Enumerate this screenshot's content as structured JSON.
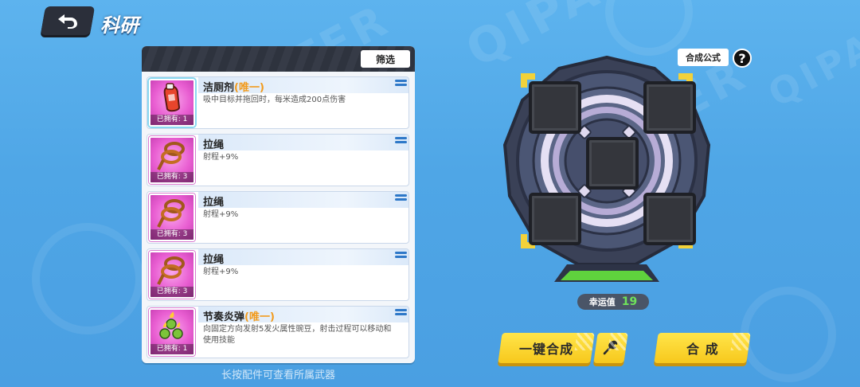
{
  "header": {
    "title": "科研",
    "back_icon": "back-arrow-icon"
  },
  "panel": {
    "filter_label": "筛选",
    "hint": "长按配件可查看所属武器",
    "items": [
      {
        "name": "洁厕剂",
        "tag": "(唯一)",
        "desc": "吸中目标并拖回时，每米造成200点伤害",
        "owned": "已拥有: 1",
        "icon": "cleaner-bottle-icon",
        "selected": true
      },
      {
        "name": "拉绳",
        "tag": "",
        "desc": "射程+9%",
        "owned": "已拥有: 3",
        "icon": "rope-icon",
        "selected": false
      },
      {
        "name": "拉绳",
        "tag": "",
        "desc": "射程+9%",
        "owned": "已拥有: 3",
        "icon": "rope-icon",
        "selected": false
      },
      {
        "name": "拉绳",
        "tag": "",
        "desc": "射程+9%",
        "owned": "已拥有: 3",
        "icon": "rope-icon",
        "selected": false
      },
      {
        "name": "节奏炎弹",
        "tag": "(唯一)",
        "desc": "向固定方向发射5发火属性豌豆，射击过程可以移动和使用技能",
        "owned": "已拥有: 1",
        "icon": "fire-peas-icon",
        "selected": false
      }
    ]
  },
  "synth": {
    "formula_label": "合成公式",
    "help_label": "?",
    "luck_label": "幸运值",
    "luck_value": "19",
    "auto_label": "一键合成",
    "synth_label": "合 成",
    "tool_icon": "wrench-icon"
  },
  "colors": {
    "accent_yellow": "#f7c81c",
    "unique_orange": "#f29a1a",
    "luck_green": "#6fe35b"
  }
}
